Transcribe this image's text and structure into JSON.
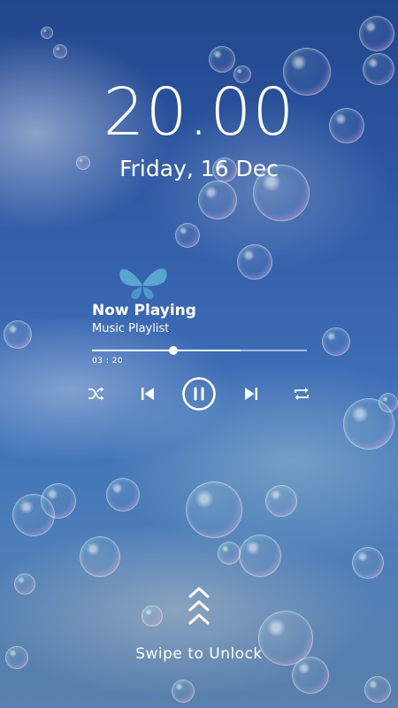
{
  "lockscreen": {
    "time": "20.00",
    "date": "Friday, 16 Dec"
  },
  "player": {
    "title": "Now Playing",
    "subtitle": "Music Playlist",
    "elapsed": "03 : 20",
    "progress_fraction": 0.38,
    "buffered_fraction": 0.69,
    "controls": {
      "shuffle_icon": "shuffle-icon",
      "previous_icon": "skip-previous-icon",
      "play_pause_icon": "pause-icon",
      "next_icon": "skip-next-icon",
      "repeat_icon": "repeat-icon"
    }
  },
  "unlock": {
    "icon": "chevron-up-icon",
    "label": "Swipe to Unlock"
  },
  "colors": {
    "foreground": "#ffffff",
    "sky_top": "#22468c",
    "sky_bottom": "#5a80ac"
  }
}
